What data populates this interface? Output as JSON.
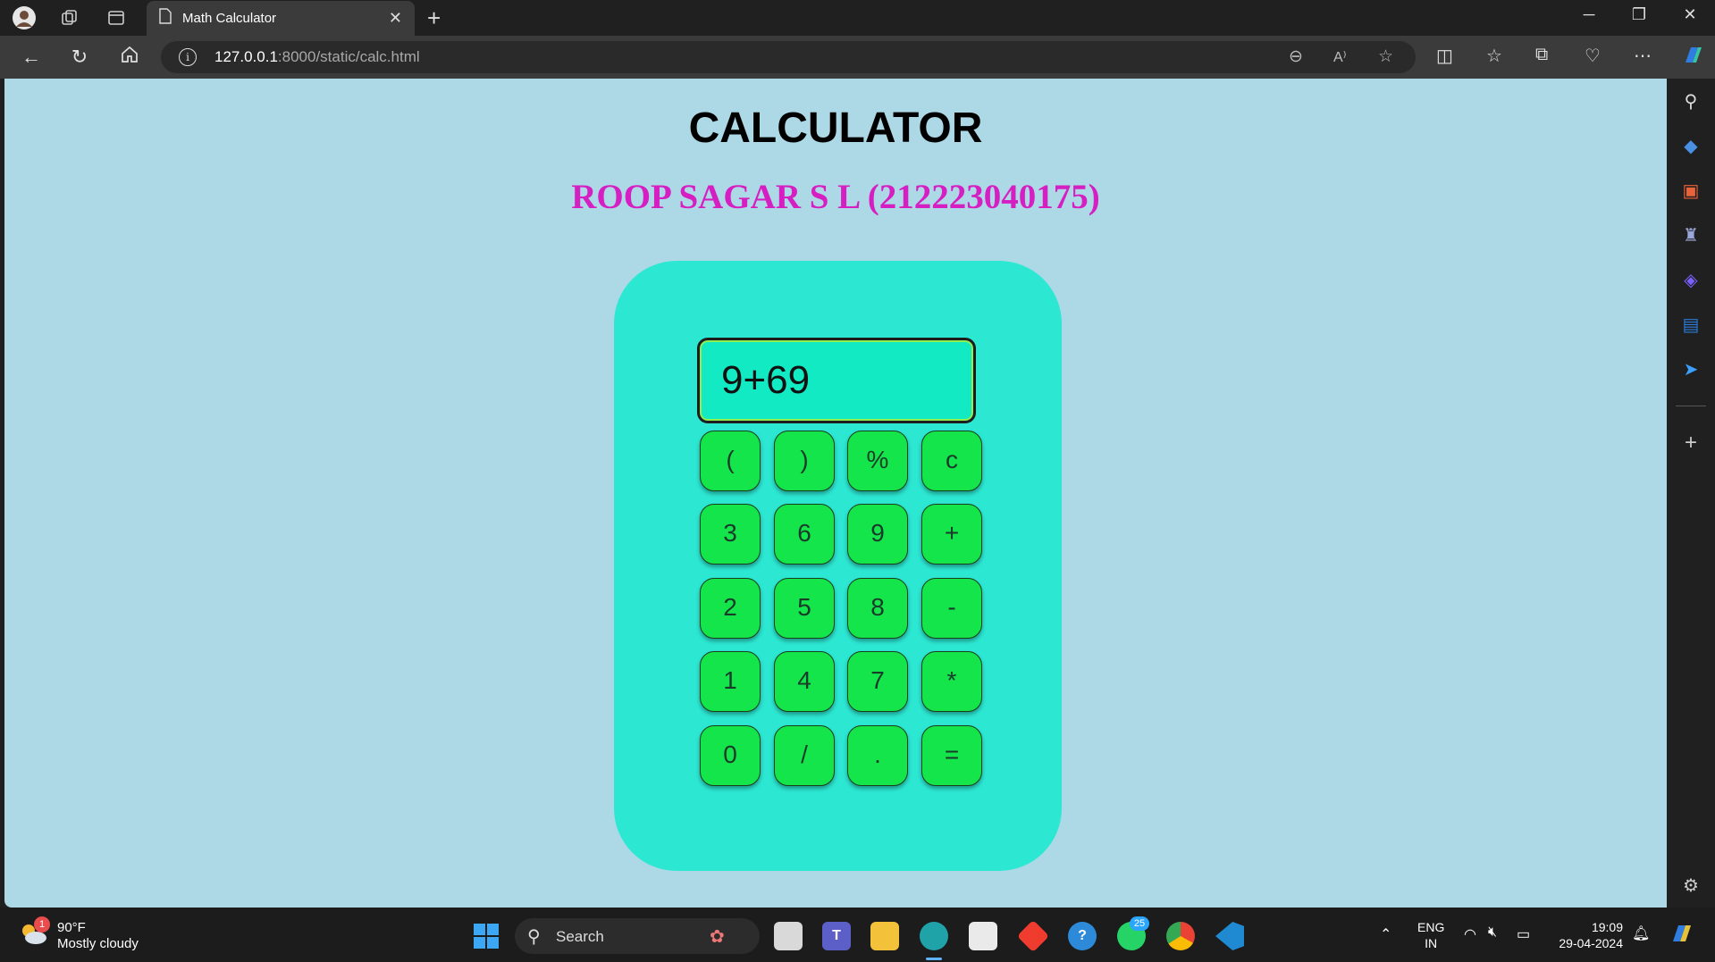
{
  "browser": {
    "tab_title": "Math Calculator",
    "url_host": "127.0.0.1",
    "url_rest": ":8000/static/calc.html"
  },
  "page": {
    "heading": "CALCULATOR",
    "subheading": "ROOP SAGAR S L (212223040175)",
    "display_value": "9+69",
    "keys": [
      [
        "(",
        ")",
        "%",
        "c"
      ],
      [
        "3",
        "6",
        "9",
        "+"
      ],
      [
        "2",
        "5",
        "8",
        "-"
      ],
      [
        "1",
        "4",
        "7",
        "*"
      ],
      [
        "0",
        "/",
        ".",
        "="
      ]
    ]
  },
  "taskbar": {
    "weather_temp": "90°F",
    "weather_desc": "Mostly cloudy",
    "weather_badge": "1",
    "search_label": "Search",
    "whatsapp_badge": "25",
    "lang_1": "ENG",
    "lang_2": "IN",
    "time": "19:09",
    "date": "29-04-2024"
  },
  "colors": {
    "page_bg": "#add8e6",
    "calc_body": "#2ce8d3",
    "display_bg": "#11eac3",
    "key_bg": "#14e54a",
    "subheading": "#d61fc3"
  }
}
